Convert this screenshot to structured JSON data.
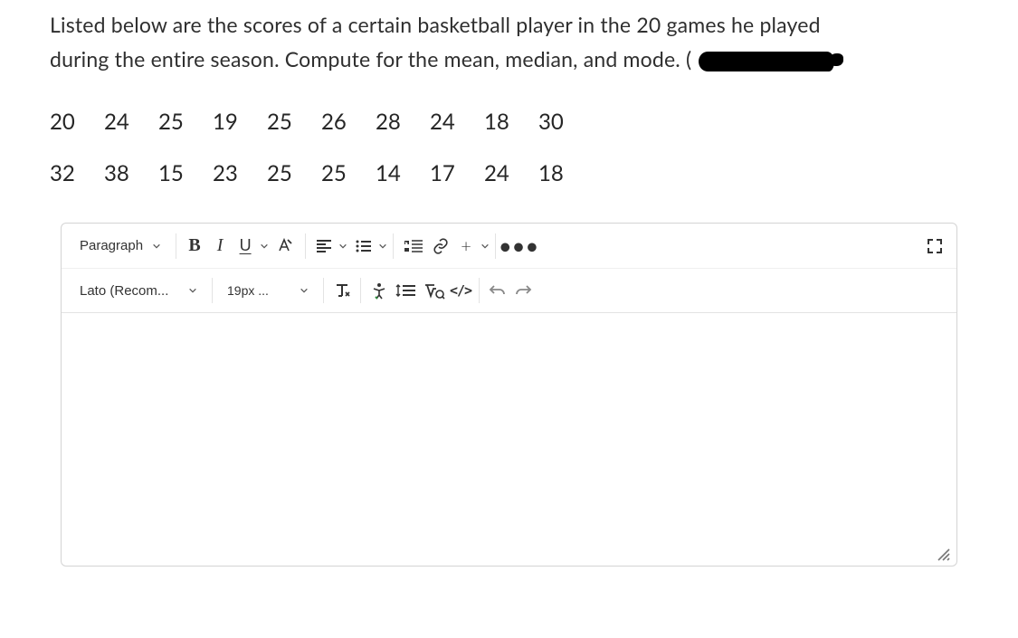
{
  "question": {
    "line1": "Listed below are the scores of a certain basketball player in the 20 games he played",
    "line2_prefix": "during the entire season. Compute for the mean, median, and mode. ("
  },
  "data_rows": [
    [
      "20",
      "24",
      "25",
      "19",
      "25",
      "26",
      "28",
      "24",
      "18",
      "30"
    ],
    [
      "32",
      "38",
      "15",
      "23",
      "25",
      "25",
      "14",
      "17",
      "24",
      "18"
    ]
  ],
  "toolbar": {
    "block_format": "Paragraph",
    "font_family": "Lato (Recom...",
    "font_size": "19px ...",
    "bold": "B",
    "italic": "I",
    "underline": "U",
    "plus": "+",
    "more": "•••",
    "code": "</>"
  }
}
